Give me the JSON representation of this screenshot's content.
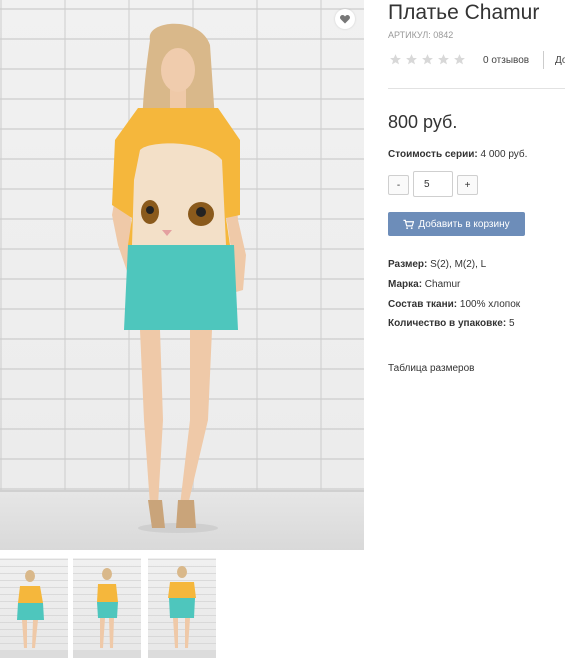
{
  "product": {
    "title": "Платье Chamur",
    "sku": "АРТИКУЛ: 0842",
    "rating_stars": 0,
    "reviews": "0 отзывов",
    "extra_link": "До",
    "price": "800 руб.",
    "series_label": "Стоимость серии:",
    "series_value": " 4 000 руб."
  },
  "quantity": {
    "minus": "-",
    "value": "5",
    "plus": "+"
  },
  "cart_button": "Добавить в корзину",
  "specs": [
    {
      "label": "Размер:",
      "value": " S(2), M(2), L"
    },
    {
      "label": "Марка:",
      "value": " Chamur"
    },
    {
      "label": "Состав ткани:",
      "value": " 100% хлопок"
    },
    {
      "label": "Количество в упаковке:",
      "value": " 5"
    }
  ],
  "size_table_link": "Таблица размеров",
  "icons": {
    "favorite": "heart-icon",
    "cart": "cart-icon",
    "star": "star-icon"
  },
  "colors": {
    "button": "#6d8db9",
    "star": "#d8d8d8",
    "dress_top": "#f5b73c",
    "dress_bottom": "#4ec6bd"
  },
  "thumbnails": [
    "front view",
    "side view",
    "back view"
  ]
}
